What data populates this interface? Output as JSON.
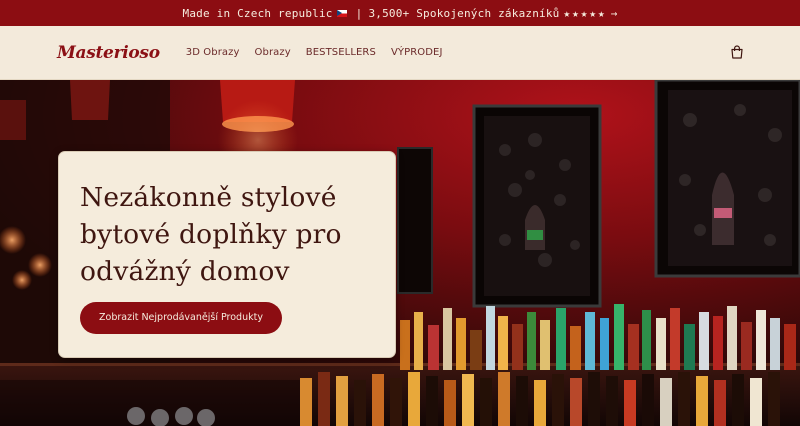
{
  "announcement": {
    "text_1": "Made in Czech republic",
    "separator": "|",
    "text_2": "3,500+ Spokojených zákazníků",
    "stars": "★★★★★",
    "arrow": "→"
  },
  "header": {
    "logo": "Masterioso",
    "nav": [
      "3D Obrazy",
      "Obrazy",
      "BESTSELLERS",
      "VÝPRODEJ"
    ],
    "cart_icon": "shopping-bag-icon"
  },
  "hero": {
    "headline": "Nezákonně stylové bytové doplňky pro odvážný domov",
    "cta_label": "Zobrazit Nejprodávanější Produkty"
  },
  "colors": {
    "brand_red": "#8c0d12",
    "cream": "#f3eadb",
    "headline": "#3f1610"
  }
}
